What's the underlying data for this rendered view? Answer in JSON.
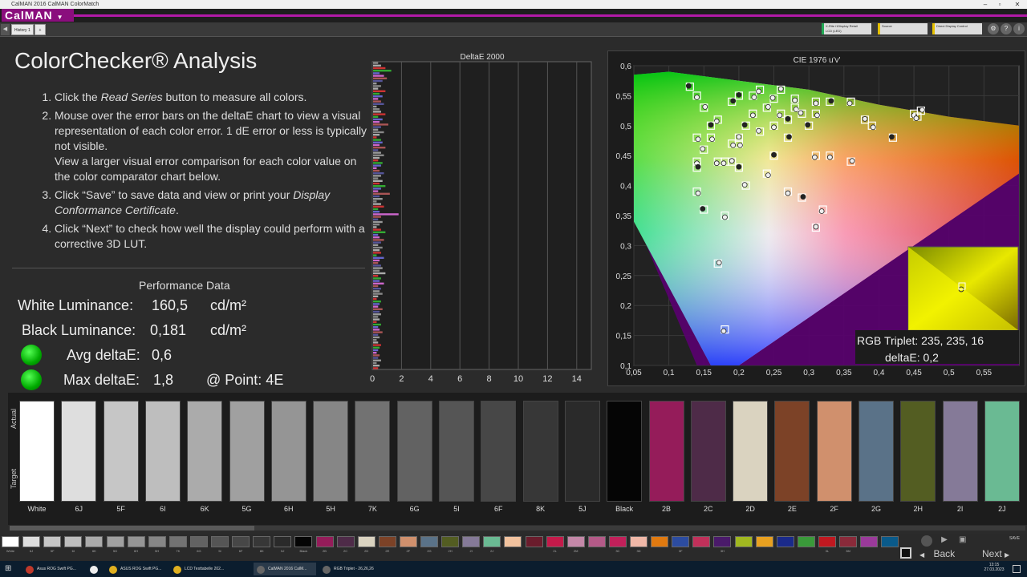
{
  "window": {
    "title": "CalMAN 2016 CalMAN ColorMatch"
  },
  "app": {
    "logo": "CalMAN"
  },
  "tabs": [
    {
      "label": "History 1"
    },
    {
      "label": "+"
    }
  ],
  "toolbar": {
    "dropdowns": [
      {
        "line1": "X-Rite i1Display Retail",
        "line2": "LCD (LED)",
        "color": "#22aa55"
      },
      {
        "line1": "Source",
        "line2": "",
        "color": "#e6c200"
      },
      {
        "line1": "Direct Display Control",
        "line2": "",
        "color": "#e6c200"
      }
    ]
  },
  "page": {
    "title": "ColorChecker® Analysis",
    "instructions": [
      {
        "prefix": "Click the ",
        "em": "Read Series",
        "suffix": " button to measure all colors."
      },
      {
        "prefix": "Mouse over the error bars on the deltaE chart to view a visual representation of each color error. 1 dE error or less is typically not visible.",
        "em": "",
        "suffix": ""
      },
      {
        "prefix": "View a larger visual error comparison for each color value on the color comparator chart below.",
        "em": "",
        "suffix": "",
        "continuation": true
      },
      {
        "prefix": "Click “Save” to save data and view or print your ",
        "em": "Display Conformance Certificate",
        "suffix": "."
      },
      {
        "prefix": "Click “Next” to check how well the display could perform with a corrective 3D LUT.",
        "em": "",
        "suffix": ""
      }
    ]
  },
  "performance": {
    "heading": "Performance Data",
    "white_label": "White Luminance:",
    "white_value": "160,5",
    "white_unit": "cd/m²",
    "black_label": "Black Luminance:",
    "black_value": "0,181",
    "black_unit": "cd/m²",
    "avg_label": "Avg deltaE:",
    "avg_value": "0,6",
    "max_label": "Max deltaE:",
    "max_value": "1,8",
    "point_label": "@ Point: 4E"
  },
  "chart_data": [
    {
      "type": "bar",
      "title": "DeltaE 2000",
      "orientation": "horizontal",
      "xlim": [
        0,
        15
      ],
      "xticks": [
        0,
        2,
        4,
        6,
        8,
        10,
        12,
        14
      ],
      "values": [
        0.4,
        0.6,
        0.9,
        1.3,
        0.5,
        0.8,
        1.0,
        0.7,
        0.3,
        0.6,
        0.4,
        0.9,
        0.5,
        0.7,
        0.4,
        0.6,
        0.8,
        0.3,
        0.5,
        0.6,
        0.9,
        0.4,
        0.7,
        0.5,
        1.1,
        0.6,
        0.4,
        0.8,
        0.5,
        0.3,
        0.6,
        0.7,
        0.5,
        0.9,
        0.4,
        0.6,
        0.8,
        0.5,
        0.4,
        0.7,
        0.6,
        0.3,
        0.5,
        0.8,
        0.6,
        0.4,
        0.7,
        0.5,
        0.9,
        0.6,
        0.4,
        1.2,
        0.5,
        0.7,
        0.3,
        0.6,
        0.8,
        0.4,
        0.5,
        1.8,
        0.6,
        0.4,
        0.7,
        0.5,
        0.3,
        0.6,
        0.9,
        0.4,
        0.5,
        0.8,
        0.6,
        0.4,
        0.7,
        0.5,
        0.6,
        0.3,
        0.8,
        0.5,
        0.4,
        0.6,
        0.7,
        0.5,
        0.9,
        0.4,
        0.6,
        0.5,
        0.8,
        0.4,
        0.6,
        0.5,
        0.7,
        0.4,
        0.3,
        0.6,
        0.5,
        0.4,
        0.7,
        0.5,
        0.6,
        0.4,
        0.5,
        0.3,
        0.6,
        0.4,
        0.5,
        0.7,
        0.4,
        0.5,
        0.3,
        0.4,
        0.6,
        0.5,
        0.4,
        0.3,
        0.5,
        0.4,
        0.6,
        0.3,
        0.5,
        0.4
      ]
    },
    {
      "type": "scatter",
      "title": "CIE 1976 u'v'",
      "xlim": [
        0.05,
        0.6
      ],
      "ylim": [
        0.1,
        0.6
      ],
      "xticks": [
        "0,05",
        "0,1",
        "0,15",
        "0,2",
        "0,25",
        "0,3",
        "0,35",
        "0,4",
        "0,45",
        "0,5",
        "0,55"
      ],
      "yticks": [
        "0,1",
        "0,15",
        "0,2",
        "0,25",
        "0,3",
        "0,35",
        "0,4",
        "0,45",
        "0,5",
        "0,55",
        "0,6"
      ],
      "points": [
        [
          0.13,
          0.565
        ],
        [
          0.14,
          0.55
        ],
        [
          0.15,
          0.53
        ],
        [
          0.17,
          0.51
        ],
        [
          0.16,
          0.5
        ],
        [
          0.14,
          0.48
        ],
        [
          0.15,
          0.46
        ],
        [
          0.14,
          0.44
        ],
        [
          0.14,
          0.43
        ],
        [
          0.17,
          0.44
        ],
        [
          0.19,
          0.44
        ],
        [
          0.2,
          0.47
        ],
        [
          0.21,
          0.5
        ],
        [
          0.22,
          0.52
        ],
        [
          0.24,
          0.53
        ],
        [
          0.26,
          0.52
        ],
        [
          0.27,
          0.51
        ],
        [
          0.28,
          0.53
        ],
        [
          0.29,
          0.52
        ],
        [
          0.31,
          0.54
        ],
        [
          0.33,
          0.54
        ],
        [
          0.36,
          0.54
        ],
        [
          0.38,
          0.51
        ],
        [
          0.39,
          0.5
        ],
        [
          0.42,
          0.48
        ],
        [
          0.45,
          0.52
        ],
        [
          0.46,
          0.525
        ],
        [
          0.455,
          0.515
        ],
        [
          0.2,
          0.55
        ],
        [
          0.22,
          0.55
        ],
        [
          0.25,
          0.545
        ],
        [
          0.28,
          0.545
        ],
        [
          0.19,
          0.54
        ],
        [
          0.23,
          0.56
        ],
        [
          0.26,
          0.56
        ],
        [
          0.31,
          0.52
        ],
        [
          0.3,
          0.5
        ],
        [
          0.33,
          0.45
        ],
        [
          0.36,
          0.44
        ],
        [
          0.31,
          0.45
        ],
        [
          0.25,
          0.45
        ],
        [
          0.24,
          0.42
        ],
        [
          0.21,
          0.4
        ],
        [
          0.27,
          0.39
        ],
        [
          0.29,
          0.38
        ],
        [
          0.32,
          0.36
        ],
        [
          0.31,
          0.33
        ],
        [
          0.14,
          0.39
        ],
        [
          0.15,
          0.36
        ],
        [
          0.18,
          0.35
        ],
        [
          0.17,
          0.27
        ],
        [
          0.18,
          0.16
        ],
        [
          0.2,
          0.43
        ],
        [
          0.19,
          0.47
        ],
        [
          0.23,
          0.49
        ],
        [
          0.25,
          0.5
        ],
        [
          0.27,
          0.48
        ],
        [
          0.18,
          0.44
        ],
        [
          0.2,
          0.48
        ],
        [
          0.16,
          0.48
        ]
      ],
      "inset": {
        "label": "RGB Triplet: 235, 235, 16",
        "delta": "deltaE: 0,2"
      }
    }
  ],
  "swatches": [
    {
      "label": "White",
      "actual": "#ffffff",
      "target": "#ffffff"
    },
    {
      "label": "6J",
      "actual": "#dedede",
      "target": "#dedede"
    },
    {
      "label": "5F",
      "actual": "#c6c6c6",
      "target": "#c6c6c6"
    },
    {
      "label": "6I",
      "actual": "#bebebe",
      "target": "#bebebe"
    },
    {
      "label": "6K",
      "actual": "#ababab",
      "target": "#ababab"
    },
    {
      "label": "5G",
      "actual": "#a0a0a0",
      "target": "#a0a0a0"
    },
    {
      "label": "6H",
      "actual": "#959595",
      "target": "#959595"
    },
    {
      "label": "5H",
      "actual": "#868686",
      "target": "#868686"
    },
    {
      "label": "7K",
      "actual": "#727272",
      "target": "#727272"
    },
    {
      "label": "6G",
      "actual": "#626262",
      "target": "#626262"
    },
    {
      "label": "5I",
      "actual": "#555555",
      "target": "#555555"
    },
    {
      "label": "6F",
      "actual": "#474747",
      "target": "#474747"
    },
    {
      "label": "8K",
      "actual": "#373737",
      "target": "#373737"
    },
    {
      "label": "5J",
      "actual": "#2a2a2a",
      "target": "#2a2a2a"
    },
    {
      "label": "Black",
      "actual": "#050505",
      "target": "#050505"
    },
    {
      "label": "2B",
      "actual": "#951c5a",
      "target": "#951c5a"
    },
    {
      "label": "2C",
      "actual": "#4e2b48",
      "target": "#4e2b48"
    },
    {
      "label": "2D",
      "actual": "#dad3c0",
      "target": "#dad3c0"
    },
    {
      "label": "2E",
      "actual": "#7c4227",
      "target": "#7c4227"
    },
    {
      "label": "2F",
      "actual": "#d0906d",
      "target": "#d0906d"
    },
    {
      "label": "2G",
      "actual": "#5a7288",
      "target": "#5a7288"
    },
    {
      "label": "2H",
      "actual": "#535d22",
      "target": "#535d22"
    },
    {
      "label": "2I",
      "actual": "#857a98",
      "target": "#857a98"
    },
    {
      "label": "2J",
      "actual": "#6aba93",
      "target": "#6aba93"
    }
  ],
  "swatch_labels": {
    "actual": "Actual",
    "target": "Target"
  },
  "strip": [
    {
      "l": "White",
      "c": "#ffffff"
    },
    {
      "l": "6J",
      "c": "#dedede"
    },
    {
      "l": "5F",
      "c": "#c6c6c6"
    },
    {
      "l": "6I",
      "c": "#bebebe"
    },
    {
      "l": "6K",
      "c": "#ababab"
    },
    {
      "l": "5G",
      "c": "#a0a0a0"
    },
    {
      "l": "6H",
      "c": "#959595"
    },
    {
      "l": "5H",
      "c": "#868686"
    },
    {
      "l": "7K",
      "c": "#727272"
    },
    {
      "l": "6G",
      "c": "#626262"
    },
    {
      "l": "5I",
      "c": "#555555"
    },
    {
      "l": "6F",
      "c": "#474747"
    },
    {
      "l": "8K",
      "c": "#373737"
    },
    {
      "l": "5J",
      "c": "#2a2a2a"
    },
    {
      "l": "Black",
      "c": "#050505"
    },
    {
      "l": "2B",
      "c": "#951c5a"
    },
    {
      "l": "2C",
      "c": "#4e2b48"
    },
    {
      "l": "2D",
      "c": "#dad3c0"
    },
    {
      "l": "2E",
      "c": "#7c4227"
    },
    {
      "l": "2F",
      "c": "#d0906d"
    },
    {
      "l": "2G",
      "c": "#5a7288"
    },
    {
      "l": "2H",
      "c": "#535d22"
    },
    {
      "l": "2I",
      "c": "#857a98"
    },
    {
      "l": "2J",
      "c": "#6aba93"
    },
    {
      "l": "",
      "c": "#f2c29e"
    },
    {
      "l": "",
      "c": "#6a1c2c"
    },
    {
      "l": "2L",
      "c": "#c41a4a"
    },
    {
      "l": "2M",
      "c": "#c488a8"
    },
    {
      "l": "",
      "c": "#b45a88"
    },
    {
      "l": "3C",
      "c": "#c2205a"
    },
    {
      "l": "3D",
      "c": "#f0b8a8"
    },
    {
      "l": "",
      "c": "#e07a10"
    },
    {
      "l": "3F",
      "c": "#2c4ca0"
    },
    {
      "l": "",
      "c": "#c0305a"
    },
    {
      "l": "3H",
      "c": "#4a1a6a"
    },
    {
      "l": "",
      "c": "#a0b820"
    },
    {
      "l": "",
      "c": "#e8a020"
    },
    {
      "l": "",
      "c": "#1a2a8a"
    },
    {
      "l": "",
      "c": "#3a9a3a"
    },
    {
      "l": "3L",
      "c": "#c01820"
    },
    {
      "l": "3M",
      "c": "#8a2a3a"
    },
    {
      "l": "",
      "c": "#9a3a9a"
    },
    {
      "l": "",
      "c": "#0a5a8a"
    },
    {
      "l": "",
      "c": "#a0d0a0"
    },
    {
      "l": "",
      "c": "#1a3a9a"
    }
  ],
  "nav": {
    "back": "Back",
    "next": "Next",
    "save": "SAVE"
  },
  "taskbar": {
    "items": [
      {
        "label": "Asus ROG Swift PG...",
        "color": "#c0392b"
      },
      {
        "label": "",
        "color": "#eeeeee"
      },
      {
        "label": "ASUS ROG Swift PG...",
        "color": "#e0b020"
      },
      {
        "label": "LCD Testtabelle 202...",
        "color": "#e0b020"
      },
      {
        "label": "CalMAN 2016 CalM...",
        "color": "#666666"
      },
      {
        "label": "RGB Triplet - 26,26,26",
        "color": "#666666"
      }
    ],
    "time": "13:15",
    "date": "27.03.2023"
  }
}
